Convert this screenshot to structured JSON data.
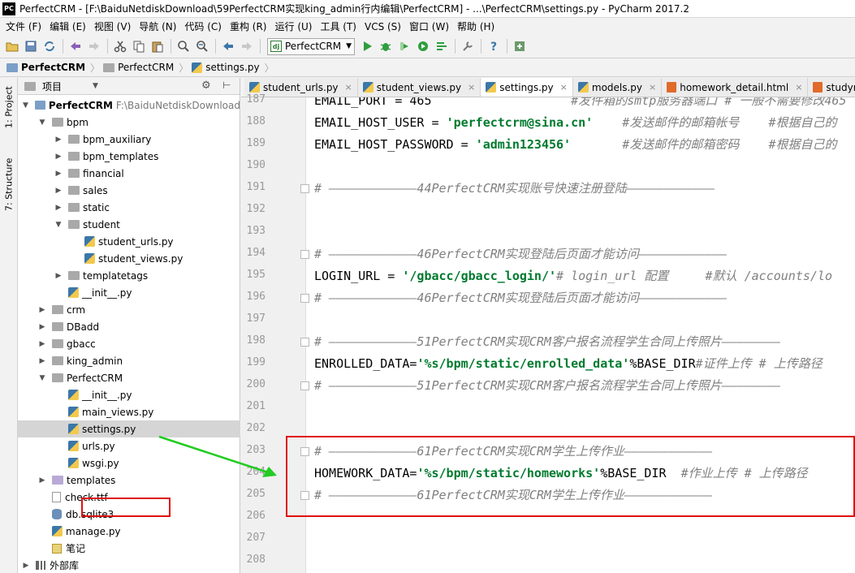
{
  "window": {
    "title": "PerfectCRM - [F:\\BaiduNetdiskDownload\\59PerfectCRM实现king_admin行内编辑\\PerfectCRM] - ...\\PerfectCRM\\settings.py - PyCharm 2017.2",
    "app_icon": "PC"
  },
  "menubar": [
    "文件 (F)",
    "编辑 (E)",
    "视图 (V)",
    "导航 (N)",
    "代码 (C)",
    "重构 (R)",
    "运行 (U)",
    "工具 (T)",
    "VCS (S)",
    "窗口 (W)",
    "帮助 (H)"
  ],
  "toolbar": {
    "run_config": "PerfectCRM"
  },
  "breadcrumb": [
    "PerfectCRM",
    "PerfectCRM",
    "settings.py"
  ],
  "side_tabs": {
    "project": "1: Project",
    "structure": "7: Structure"
  },
  "project_panel": {
    "title": "项目",
    "tree": [
      {
        "label": "PerfectCRM",
        "path": "F:\\BaiduNetdiskDownload",
        "indent": 0,
        "type": "folder-blue",
        "expanded": true,
        "bold": true
      },
      {
        "label": "bpm",
        "indent": 1,
        "type": "folder",
        "expanded": true
      },
      {
        "label": "bpm_auxiliary",
        "indent": 2,
        "type": "folder",
        "expanded": false
      },
      {
        "label": "bpm_templates",
        "indent": 2,
        "type": "folder",
        "expanded": false
      },
      {
        "label": "financial",
        "indent": 2,
        "type": "folder",
        "expanded": false
      },
      {
        "label": "sales",
        "indent": 2,
        "type": "folder",
        "expanded": false
      },
      {
        "label": "static",
        "indent": 2,
        "type": "folder",
        "expanded": false
      },
      {
        "label": "student",
        "indent": 2,
        "type": "folder",
        "expanded": true
      },
      {
        "label": "student_urls.py",
        "indent": 3,
        "type": "py"
      },
      {
        "label": "student_views.py",
        "indent": 3,
        "type": "py"
      },
      {
        "label": "templatetags",
        "indent": 2,
        "type": "folder",
        "expanded": false
      },
      {
        "label": "__init__.py",
        "indent": 2,
        "type": "py"
      },
      {
        "label": "crm",
        "indent": 1,
        "type": "folder",
        "expanded": false
      },
      {
        "label": "DBadd",
        "indent": 1,
        "type": "folder",
        "expanded": false
      },
      {
        "label": "gbacc",
        "indent": 1,
        "type": "folder",
        "expanded": false
      },
      {
        "label": "king_admin",
        "indent": 1,
        "type": "folder",
        "expanded": false
      },
      {
        "label": "PerfectCRM",
        "indent": 1,
        "type": "folder",
        "expanded": true
      },
      {
        "label": "__init__.py",
        "indent": 2,
        "type": "py"
      },
      {
        "label": "main_views.py",
        "indent": 2,
        "type": "py"
      },
      {
        "label": "settings.py",
        "indent": 2,
        "type": "py",
        "selected": true
      },
      {
        "label": "urls.py",
        "indent": 2,
        "type": "py"
      },
      {
        "label": "wsgi.py",
        "indent": 2,
        "type": "py"
      },
      {
        "label": "templates",
        "indent": 1,
        "type": "folder-lilac",
        "expanded": false
      },
      {
        "label": "check.ttf",
        "indent": 1,
        "type": "file"
      },
      {
        "label": "db.sqlite3",
        "indent": 1,
        "type": "db"
      },
      {
        "label": "manage.py",
        "indent": 1,
        "type": "py"
      },
      {
        "label": "笔记",
        "indent": 1,
        "type": "note"
      },
      {
        "label": "外部库",
        "indent": 0,
        "type": "lib",
        "expanded": false
      }
    ]
  },
  "editor": {
    "tabs": [
      {
        "label": "student_urls.py",
        "type": "py",
        "active": false
      },
      {
        "label": "student_views.py",
        "type": "py",
        "active": false
      },
      {
        "label": "settings.py",
        "type": "py",
        "active": true
      },
      {
        "label": "models.py",
        "type": "py",
        "active": false
      },
      {
        "label": "homework_detail.html",
        "type": "html",
        "active": false
      },
      {
        "label": "studyrec",
        "type": "html",
        "active": false
      }
    ],
    "lines": [
      {
        "num": "187",
        "parts": [
          {
            "t": "EMAIL_PORT = 465",
            "c": ""
          },
          {
            "t": "                   #发件箱的smtp服务器端口 # 一般不需要修改465",
            "c": "cmt"
          }
        ]
      },
      {
        "num": "188",
        "parts": [
          {
            "t": "EMAIL_HOST_USER = ",
            "c": ""
          },
          {
            "t": "'perfectcrm@sina.cn'",
            "c": "str"
          },
          {
            "t": "    #发送邮件的邮箱帐号    #根据自己的",
            "c": "cmt"
          }
        ]
      },
      {
        "num": "189",
        "parts": [
          {
            "t": "EMAIL_HOST_PASSWORD = ",
            "c": ""
          },
          {
            "t": "'admin123456'",
            "c": "str"
          },
          {
            "t": "       #发送邮件的邮箱密码    #根据自己的",
            "c": "cmt"
          }
        ]
      },
      {
        "num": "190",
        "parts": []
      },
      {
        "num": "191",
        "parts": [
          {
            "t": "# ————————————44PerfectCRM实现账号快速注册登陆————————————",
            "c": "cmt"
          }
        ]
      },
      {
        "num": "192",
        "parts": []
      },
      {
        "num": "193",
        "parts": []
      },
      {
        "num": "194",
        "parts": [
          {
            "t": "# ————————————46PerfectCRM实现登陆后页面才能访问————————————",
            "c": "cmt"
          }
        ]
      },
      {
        "num": "195",
        "parts": [
          {
            "t": "LOGIN_URL = ",
            "c": ""
          },
          {
            "t": "'/gbacc/gbacc_login/'",
            "c": "str"
          },
          {
            "t": "# login_url 配置     #默认 /accounts/lo",
            "c": "cmt"
          }
        ]
      },
      {
        "num": "196",
        "parts": [
          {
            "t": "# ————————————46PerfectCRM实现登陆后页面才能访问————————————",
            "c": "cmt"
          }
        ]
      },
      {
        "num": "197",
        "parts": []
      },
      {
        "num": "198",
        "parts": [
          {
            "t": "# ————————————51PerfectCRM实现CRM客户报名流程学生合同上传照片————————",
            "c": "cmt"
          }
        ]
      },
      {
        "num": "199",
        "parts": [
          {
            "t": "ENROLLED_DATA=",
            "c": ""
          },
          {
            "t": "'%s/bpm/static/enrolled_data'",
            "c": "str"
          },
          {
            "t": "%BASE_DIR",
            "c": ""
          },
          {
            "t": "#证件上传 # 上传路径",
            "c": "cmt"
          }
        ]
      },
      {
        "num": "200",
        "parts": [
          {
            "t": "# ————————————51PerfectCRM实现CRM客户报名流程学生合同上传照片————————",
            "c": "cmt"
          }
        ]
      },
      {
        "num": "201",
        "parts": []
      },
      {
        "num": "202",
        "parts": []
      },
      {
        "num": "203",
        "parts": [
          {
            "t": "# ————————————61PerfectCRM实现CRM学生上传作业————————————",
            "c": "cmt"
          }
        ]
      },
      {
        "num": "204",
        "parts": [
          {
            "t": "HOMEWORK_DATA=",
            "c": ""
          },
          {
            "t": "'%s/bpm/static/homeworks'",
            "c": "str"
          },
          {
            "t": "%BASE_DIR  ",
            "c": ""
          },
          {
            "t": "#作业上传 # 上传路径",
            "c": "cmt"
          }
        ]
      },
      {
        "num": "205",
        "parts": [
          {
            "t": "# ————————————61PerfectCRM实现CRM学生上传作业————————————",
            "c": "cmt"
          }
        ]
      },
      {
        "num": "206",
        "parts": []
      },
      {
        "num": "207",
        "parts": []
      },
      {
        "num": "208",
        "parts": []
      }
    ],
    "fold_marker_lines": [
      "191",
      "194",
      "196",
      "198",
      "200",
      "203",
      "205"
    ]
  },
  "annotation": {
    "box_color": "#e01010",
    "arrow_color": "#22cc22"
  }
}
